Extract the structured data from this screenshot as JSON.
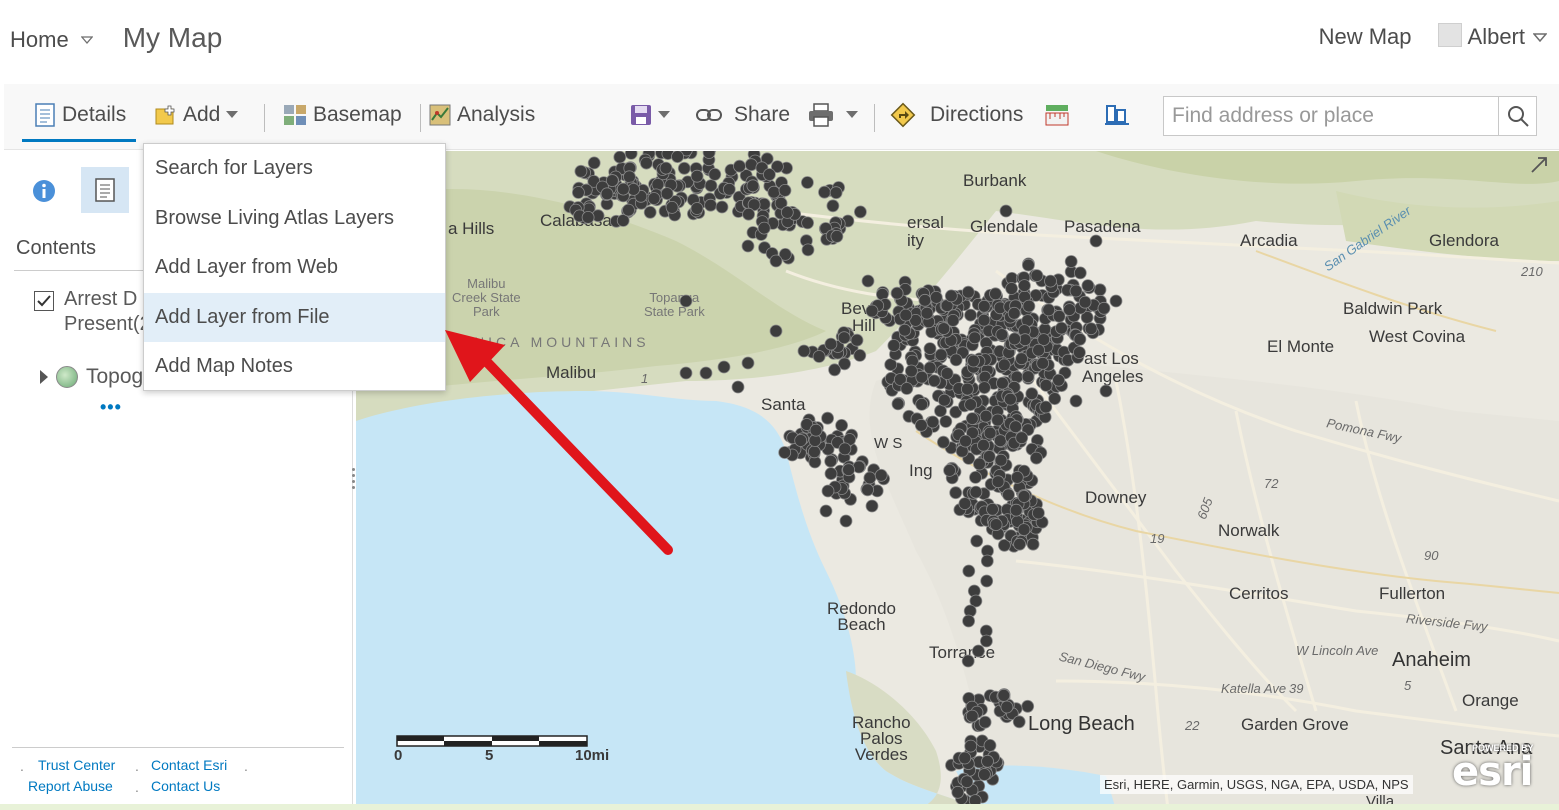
{
  "header": {
    "home_label": "Home",
    "map_title": "My Map",
    "new_map_label": "New Map",
    "user_name": "Albert"
  },
  "toolbar": {
    "details_label": "Details",
    "add_label": "Add",
    "basemap_label": "Basemap",
    "analysis_label": "Analysis",
    "share_label": "Share",
    "directions_label": "Directions",
    "search_placeholder": "Find address or place"
  },
  "add_menu": {
    "items": [
      "Search for Layers",
      "Browse Living Atlas Layers",
      "Add Layer from Web",
      "Add Layer from File",
      "Add Map Notes"
    ],
    "highlighted": "Add Layer from File"
  },
  "left_panel": {
    "contents_label": "Contents",
    "layer1_line1": "Arrest D",
    "layer1_line2": "Present(2",
    "layer2_label": "Topog",
    "more_label": "•••",
    "footer": {
      "trust_center": "Trust Center",
      "contact_esri": "Contact Esri",
      "report_abuse": "Report Abuse",
      "contact_us": "Contact Us"
    }
  },
  "map": {
    "labels": {
      "burbank": "Burbank",
      "calabasas": "Calabasas",
      "hills": "a Hills",
      "glendale": "Glendale",
      "pasadena": "Pasadena",
      "arcadia": "Arcadia",
      "glendora": "Glendora",
      "versal": "ersal",
      "ity": "ity",
      "malibu_creek": "Malibu\nCreek State\nPark",
      "topanga": "Topanga\nState Park",
      "mountains": "NICA MOUNTAINS",
      "beverly": "Bev",
      "hill": "Hill",
      "baldwin": "Baldwin Park",
      "west_covina": "West Covina",
      "el_monte": "El Monte",
      "east_los": "ast Los",
      "angeles": "Angeles",
      "malibu": "Malibu",
      "santa_monica": "Santa",
      "pomona_fwy": "Pomona Fwy",
      "w_s": "W S",
      "ing": "Ing",
      "downey": "Downey",
      "norwalk": "Norwalk",
      "cerritos": "Cerritos",
      "fullerton": "Fullerton",
      "riverside_fwy": "Riverside Fwy",
      "w_lincoln": "W Lincoln Ave",
      "anaheim": "Anaheim",
      "katella": "Katella Ave",
      "orange": "Orange",
      "garden_grove": "Garden Grove",
      "redondo": "Redondo\nBeach",
      "torrance": "Torrance",
      "san_diego_fwy": "San Diego Fwy",
      "rancho": "Rancho\nPalos\nVerdes",
      "long_beach": "Long Beach",
      "santa_ana": "Santa Ana",
      "villa": "Villa",
      "hwy210": "210",
      "hwy1": "1",
      "hwy605": "605",
      "hwy22": "22",
      "hwy39": "39",
      "hwy90": "90",
      "hwy72": "72",
      "hwy19": "19",
      "hwy5": "5",
      "river": "San Gabriel River"
    },
    "scale": {
      "zero": "0",
      "mid": "5",
      "end": "10mi"
    },
    "attribution": "Esri, HERE, Garmin, USGS, NGA, EPA, USDA, NPS",
    "powered_by": "POWERED BY",
    "esri_logo": "esri"
  },
  "colors": {
    "accent": "#0079c1",
    "menu_highlight": "#e2eef8",
    "water": "#c6e6f6",
    "points": "#3d3d3d",
    "arrow": "#e0151b"
  }
}
